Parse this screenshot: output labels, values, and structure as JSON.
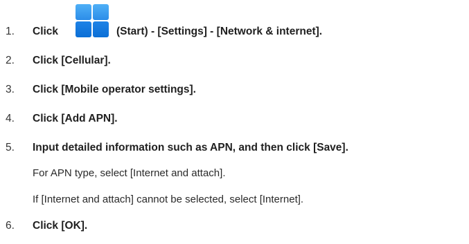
{
  "steps": [
    {
      "num": "1.",
      "prefix": "Click",
      "suffix": "(Start) - [Settings] - [Network & internet]."
    },
    {
      "num": "2.",
      "text": "Click [Cellular]."
    },
    {
      "num": "3.",
      "text": "Click [Mobile operator settings]."
    },
    {
      "num": "4.",
      "text": "Click [Add APN]."
    },
    {
      "num": "5.",
      "text": "Input detailed information such as APN, and then click [Save]."
    },
    {
      "num": "6.",
      "text": "Click [OK]."
    }
  ],
  "notes": [
    "For APN type, select [Internet and attach].",
    "If [Internet and attach] cannot be selected, select [Internet]."
  ],
  "icons": {
    "start": "windows-start-icon",
    "colors": {
      "tile_top": "#3fa3f3",
      "tile_bottom": "#0b6fd6"
    }
  }
}
